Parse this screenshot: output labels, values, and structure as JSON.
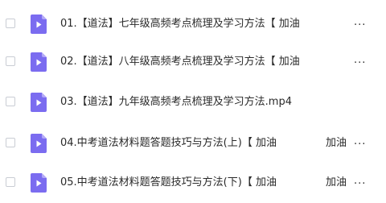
{
  "files": [
    {
      "name": "01.【道法】七年级高频考点梳理及学习方法【 加油",
      "tail": "",
      "more": "..."
    },
    {
      "name": "02.【道法】八年级高频考点梳理及学习方法【 加油",
      "tail": "",
      "more": "..."
    },
    {
      "name": "03.【道法】九年级高频考点梳理及学习方法.mp4",
      "tail": "",
      "more": ""
    },
    {
      "name": "04.中考道法材料题答题技巧与方法(上)【 加油",
      "tail": "加油",
      "more": "..."
    },
    {
      "name": "05.中考道法材料题答题技巧与方法(下)【 加油",
      "tail": "加油",
      "more": "..."
    }
  ],
  "icon": {
    "type": "video-file-icon",
    "color": "#7b6cf0",
    "fold_color": "#b3a9f7"
  }
}
